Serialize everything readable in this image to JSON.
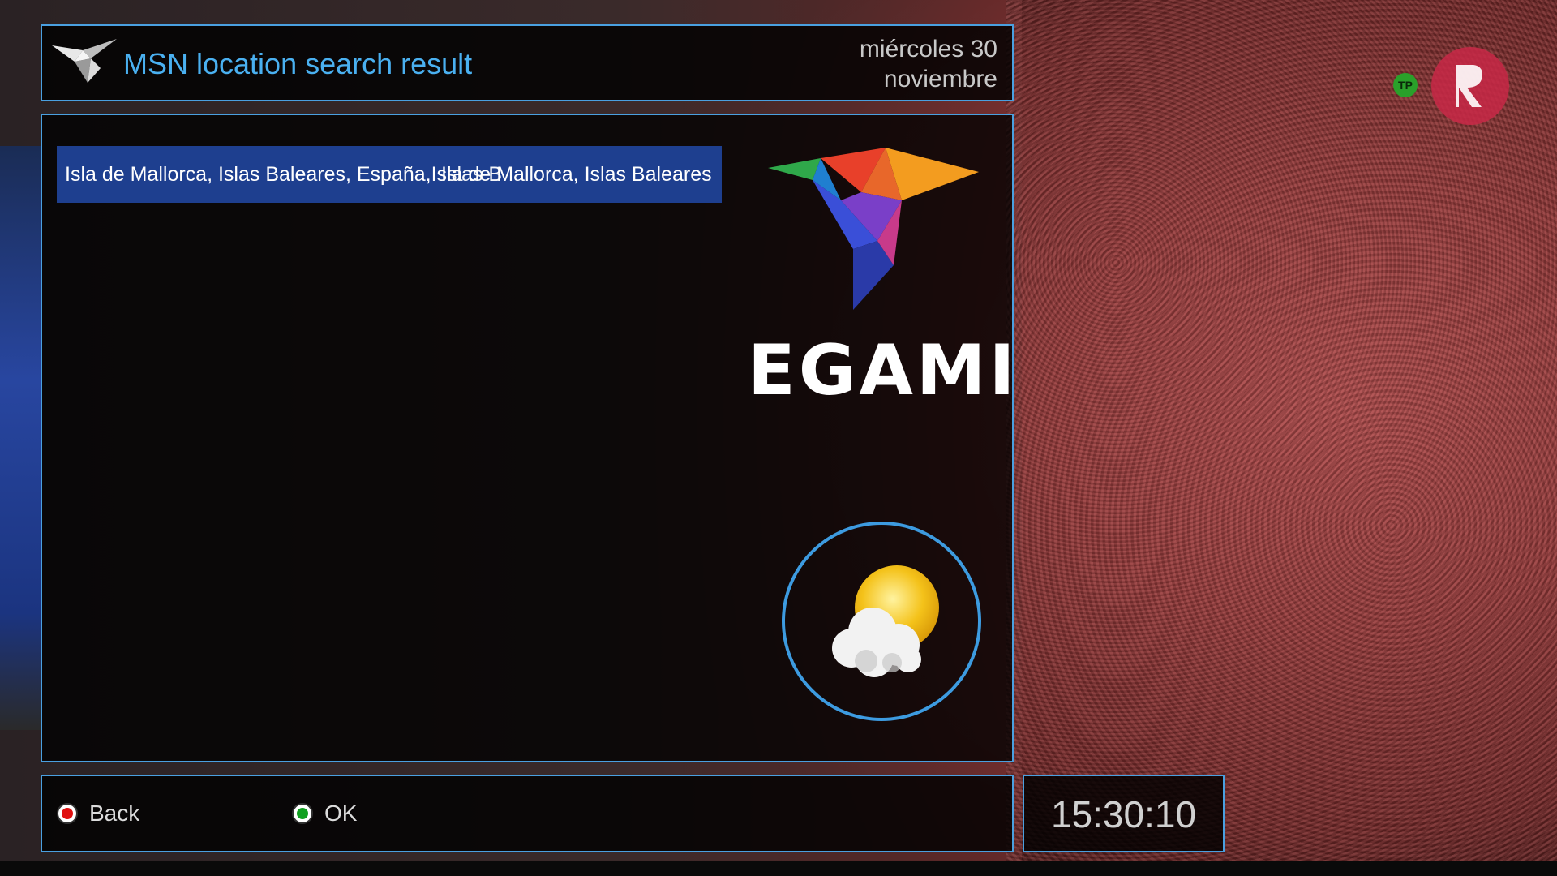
{
  "header": {
    "title": "MSN location search result",
    "date_line1": "miércoles 30",
    "date_line2": "noviembre"
  },
  "results": {
    "selected_item": "Isla de Mallorca, Islas Baleares, España,Isla de Mallorca, Islas Baleares",
    "overlap_text": "Islas B"
  },
  "brand": {
    "name": "EGAMI"
  },
  "footer": {
    "back_label": "Back",
    "ok_label": "OK"
  },
  "clock": {
    "time": "15:30:10"
  },
  "overlay": {
    "channel_badge": "TP"
  },
  "colors": {
    "accent": "#4ab0f0",
    "selection": "#1e3f8f",
    "border": "#4aa0e0",
    "back_button": "#e01010",
    "ok_button": "#10a020"
  },
  "icons": {
    "header_logo": "origami-bird-icon",
    "weather": "partly-cloudy-icon"
  }
}
